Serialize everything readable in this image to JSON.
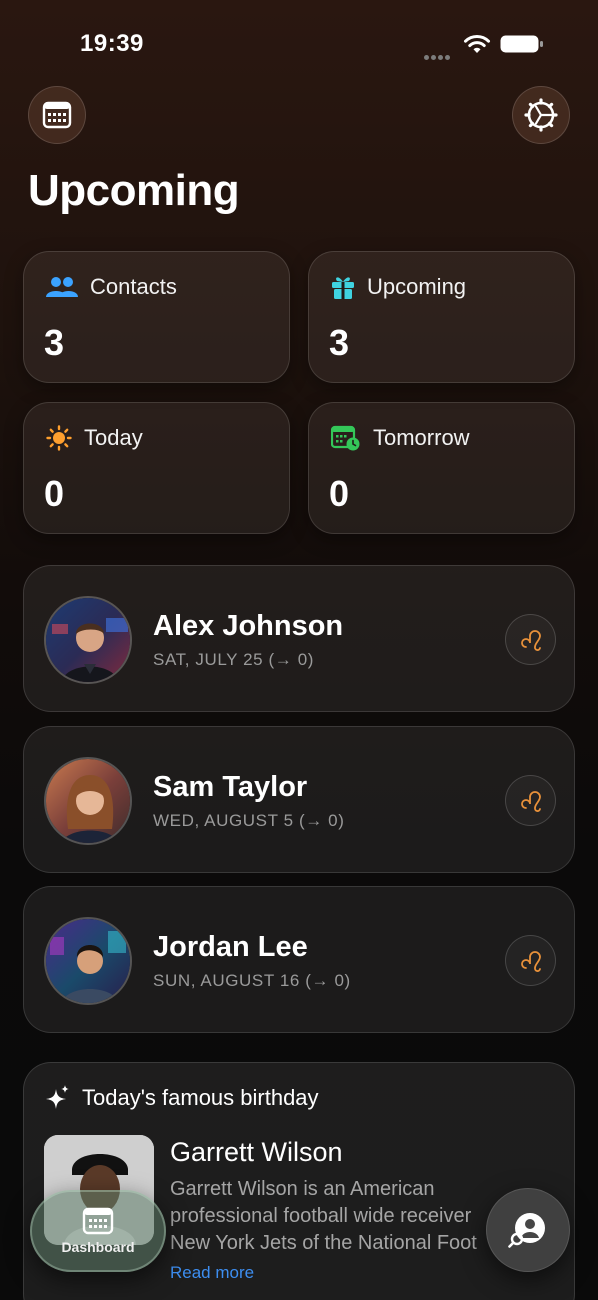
{
  "status_bar": {
    "time": "19:39"
  },
  "header": {
    "title": "Upcoming"
  },
  "stats": [
    {
      "label": "Contacts",
      "value": "3",
      "icon": "people-icon",
      "color": "#3ba3ff"
    },
    {
      "label": "Upcoming",
      "value": "3",
      "icon": "gift-icon",
      "color": "#3fd3e0"
    },
    {
      "label": "Today",
      "value": "0",
      "icon": "sun-icon",
      "color": "#ff9f2e"
    },
    {
      "label": "Tomorrow",
      "value": "0",
      "icon": "calendar-clock-icon",
      "color": "#34c759"
    }
  ],
  "people": [
    {
      "name": "Alex Johnson",
      "date": "SAT, JULY 25  (→ 0)",
      "zodiac": "leo-icon"
    },
    {
      "name": "Sam Taylor",
      "date": "WED, AUGUST 5  (→ 0)",
      "zodiac": "leo-icon"
    },
    {
      "name": "Jordan Lee",
      "date": "SUN, AUGUST 16  (→ 0)",
      "zodiac": "leo-icon"
    }
  ],
  "famous": {
    "title": "Today's famous birthday",
    "name": "Garrett Wilson",
    "description_lines": [
      "Garrett Wilson  is an American",
      "professional football wide receiver",
      "New York Jets of the National Foot"
    ],
    "read_more": "Read more"
  },
  "tab_bar": {
    "dashboard_label": "Dashboard"
  },
  "colors": {
    "accent_orange": "#e8913a",
    "link_blue": "#3d8ef0"
  }
}
